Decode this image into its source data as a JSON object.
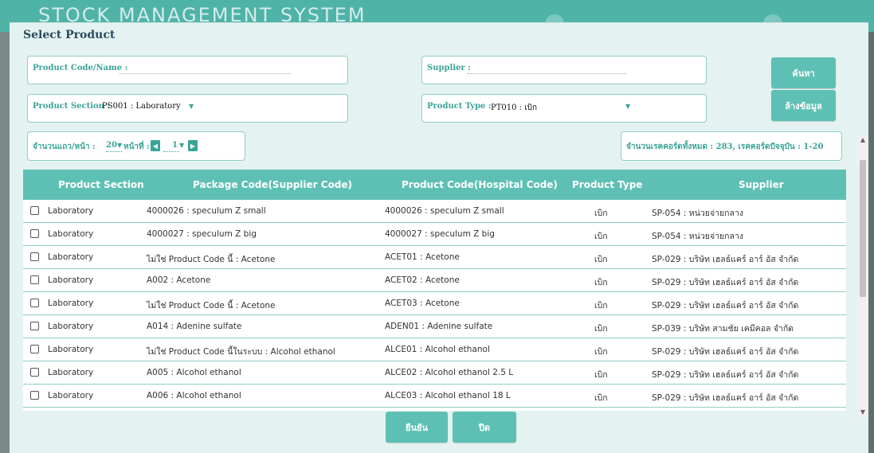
{
  "app": {
    "title": "STOCK MANAGEMENT SYSTEM"
  },
  "dialog": {
    "title": "Select Product"
  },
  "filters": {
    "product_code_label": "Product Code/Name :",
    "product_code_value": "",
    "supplier_label": "Supplier :",
    "supplier_value": "",
    "section_label": "Product Section :",
    "section_value": "PS001 : Laboratory",
    "type_label": "Product Type :",
    "type_value": "PT010 : เบิก"
  },
  "buttons": {
    "search": "ค้นหา",
    "clear": "ล้างข้อมูล",
    "confirm": "ยืนยัน",
    "close": "ปิด"
  },
  "pager": {
    "rows_label": "จำนวนแถว/หน้า :",
    "rows_value": "20",
    "page_label": "หน้าที่ :",
    "page_value": "1",
    "records_text": "จำนวนเรคคอร์ดทั้งหมด : 283, เรคคอร์ดปัจจุบัน : 1-20"
  },
  "table": {
    "columns": [
      "Product Section",
      "Package Code(Supplier Code)",
      "Product Code(Hospital Code)",
      "Product Type",
      "Supplier"
    ],
    "rows": [
      [
        "Laboratory",
        "4000026 : speculum Z small",
        "4000026 : speculum Z small",
        "เบิก",
        "SP-054 : หน่วยจ่ายกลาง"
      ],
      [
        "Laboratory",
        "4000027 : speculum Z big",
        "4000027 : speculum Z big",
        "เบิก",
        "SP-054 : หน่วยจ่ายกลาง"
      ],
      [
        "Laboratory",
        "ไม่ใช่ Product Code นี้ : Acetone",
        "ACET01 : Acetone",
        "เบิก",
        "SP-029 : บริษัท เฮลธ์แคร์ อาร์ อัส จำกัด"
      ],
      [
        "Laboratory",
        "A002 : Acetone",
        "ACET02 : Acetone",
        "เบิก",
        "SP-029 : บริษัท เฮลธ์แคร์ อาร์ อัส จำกัด"
      ],
      [
        "Laboratory",
        "ไม่ใช่ Product Code นี้ : Acetone",
        "ACET03 : Acetone",
        "เบิก",
        "SP-029 : บริษัท เฮลธ์แคร์ อาร์ อัส จำกัด"
      ],
      [
        "Laboratory",
        "A014 : Adenine sulfate",
        "ADEN01 : Adenine sulfate",
        "เบิก",
        "SP-039 : บริษัท สามชัย เคมีคอล จำกัด"
      ],
      [
        "Laboratory",
        "ไม่ใช่ Product Code นี้ในระบบ : Alcohol ethanol",
        "ALCE01 : Alcohol ethanol",
        "เบิก",
        "SP-029 : บริษัท เฮลธ์แคร์ อาร์ อัส จำกัด"
      ],
      [
        "Laboratory",
        "A005 : Alcohol ethanol",
        "ALCE02 : Alcohol ethanol 2.5 L",
        "เบิก",
        "SP-029 : บริษัท เฮลธ์แคร์ อาร์ อัส จำกัด"
      ],
      [
        "Laboratory",
        "A006 : Alcohol ethanol",
        "ALCE03 : Alcohol ethanol 18 L",
        "เบิก",
        "SP-029 : บริษัท เฮลธ์แคร์ อาร์ อัส จำกัด"
      ]
    ]
  },
  "colors": {
    "accent": "#5ec0b4",
    "label": "#3aa397",
    "background": "#e4f3f1"
  },
  "icons": {
    "prev": "caret-left-icon",
    "next": "caret-right-icon",
    "dropdown": "caret-down-icon",
    "checkbox": "checkbox-icon"
  }
}
